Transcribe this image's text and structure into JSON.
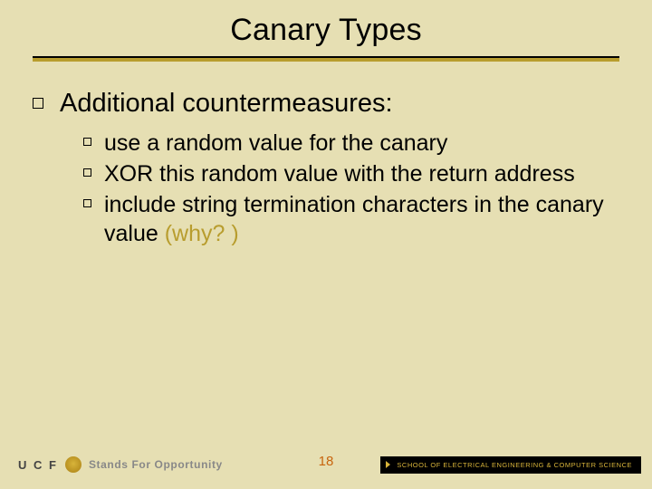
{
  "title": "Canary Types",
  "heading": "Additional countermeasures:",
  "bullets": [
    "use a random value for the canary",
    "XOR this random value with the return address",
    "include string termination characters in the canary value"
  ],
  "why": "  (why? )",
  "page_number": "18",
  "footer": {
    "ucf": "U C F",
    "tagline": "Stands For Opportunity",
    "school": "SCHOOL OF ELECTRICAL ENGINEERING & COMPUTER SCIENCE"
  }
}
